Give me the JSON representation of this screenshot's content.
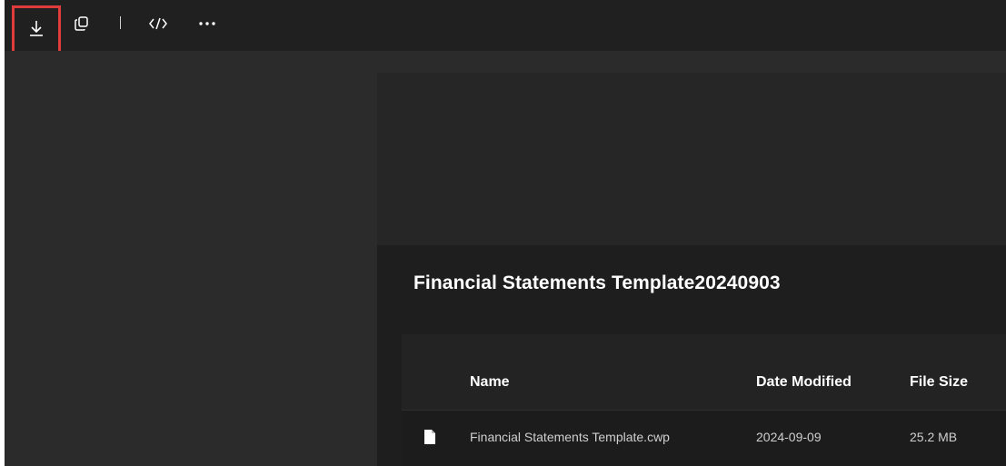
{
  "toolbar": {
    "buttons": [
      {
        "icon": "download-icon"
      },
      {
        "icon": "copy-icon"
      },
      {
        "icon": "code-icon"
      },
      {
        "icon": "more-icon"
      }
    ],
    "highlight_color": "#e03c3c"
  },
  "folder": {
    "title": "Financial Statements Template20240903",
    "columns": {
      "name": "Name",
      "date": "Date Modified",
      "size": "File Size"
    },
    "files": [
      {
        "icon": "file-icon",
        "name": "Financial Statements Template.cwp",
        "date": "2024-09-09",
        "size": "25.2 MB"
      }
    ]
  }
}
